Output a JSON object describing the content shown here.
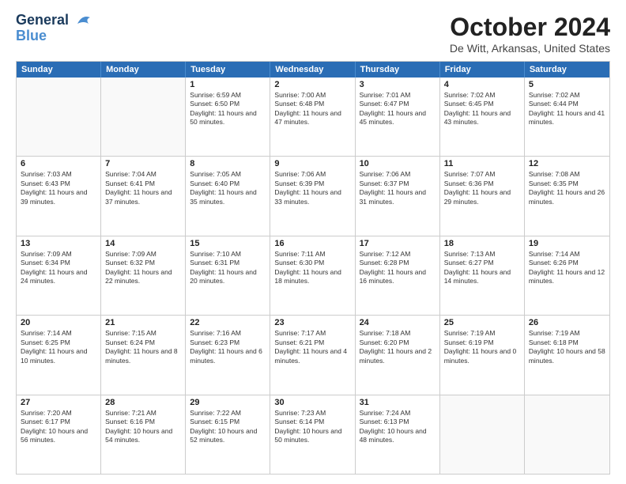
{
  "logo": {
    "line1": "General",
    "line2": "Blue"
  },
  "title": "October 2024",
  "location": "De Witt, Arkansas, United States",
  "days_of_week": [
    "Sunday",
    "Monday",
    "Tuesday",
    "Wednesday",
    "Thursday",
    "Friday",
    "Saturday"
  ],
  "weeks": [
    [
      {
        "day": "",
        "sunrise": "",
        "sunset": "",
        "daylight": ""
      },
      {
        "day": "",
        "sunrise": "",
        "sunset": "",
        "daylight": ""
      },
      {
        "day": "1",
        "sunrise": "Sunrise: 6:59 AM",
        "sunset": "Sunset: 6:50 PM",
        "daylight": "Daylight: 11 hours and 50 minutes."
      },
      {
        "day": "2",
        "sunrise": "Sunrise: 7:00 AM",
        "sunset": "Sunset: 6:48 PM",
        "daylight": "Daylight: 11 hours and 47 minutes."
      },
      {
        "day": "3",
        "sunrise": "Sunrise: 7:01 AM",
        "sunset": "Sunset: 6:47 PM",
        "daylight": "Daylight: 11 hours and 45 minutes."
      },
      {
        "day": "4",
        "sunrise": "Sunrise: 7:02 AM",
        "sunset": "Sunset: 6:45 PM",
        "daylight": "Daylight: 11 hours and 43 minutes."
      },
      {
        "day": "5",
        "sunrise": "Sunrise: 7:02 AM",
        "sunset": "Sunset: 6:44 PM",
        "daylight": "Daylight: 11 hours and 41 minutes."
      }
    ],
    [
      {
        "day": "6",
        "sunrise": "Sunrise: 7:03 AM",
        "sunset": "Sunset: 6:43 PM",
        "daylight": "Daylight: 11 hours and 39 minutes."
      },
      {
        "day": "7",
        "sunrise": "Sunrise: 7:04 AM",
        "sunset": "Sunset: 6:41 PM",
        "daylight": "Daylight: 11 hours and 37 minutes."
      },
      {
        "day": "8",
        "sunrise": "Sunrise: 7:05 AM",
        "sunset": "Sunset: 6:40 PM",
        "daylight": "Daylight: 11 hours and 35 minutes."
      },
      {
        "day": "9",
        "sunrise": "Sunrise: 7:06 AM",
        "sunset": "Sunset: 6:39 PM",
        "daylight": "Daylight: 11 hours and 33 minutes."
      },
      {
        "day": "10",
        "sunrise": "Sunrise: 7:06 AM",
        "sunset": "Sunset: 6:37 PM",
        "daylight": "Daylight: 11 hours and 31 minutes."
      },
      {
        "day": "11",
        "sunrise": "Sunrise: 7:07 AM",
        "sunset": "Sunset: 6:36 PM",
        "daylight": "Daylight: 11 hours and 29 minutes."
      },
      {
        "day": "12",
        "sunrise": "Sunrise: 7:08 AM",
        "sunset": "Sunset: 6:35 PM",
        "daylight": "Daylight: 11 hours and 26 minutes."
      }
    ],
    [
      {
        "day": "13",
        "sunrise": "Sunrise: 7:09 AM",
        "sunset": "Sunset: 6:34 PM",
        "daylight": "Daylight: 11 hours and 24 minutes."
      },
      {
        "day": "14",
        "sunrise": "Sunrise: 7:09 AM",
        "sunset": "Sunset: 6:32 PM",
        "daylight": "Daylight: 11 hours and 22 minutes."
      },
      {
        "day": "15",
        "sunrise": "Sunrise: 7:10 AM",
        "sunset": "Sunset: 6:31 PM",
        "daylight": "Daylight: 11 hours and 20 minutes."
      },
      {
        "day": "16",
        "sunrise": "Sunrise: 7:11 AM",
        "sunset": "Sunset: 6:30 PM",
        "daylight": "Daylight: 11 hours and 18 minutes."
      },
      {
        "day": "17",
        "sunrise": "Sunrise: 7:12 AM",
        "sunset": "Sunset: 6:28 PM",
        "daylight": "Daylight: 11 hours and 16 minutes."
      },
      {
        "day": "18",
        "sunrise": "Sunrise: 7:13 AM",
        "sunset": "Sunset: 6:27 PM",
        "daylight": "Daylight: 11 hours and 14 minutes."
      },
      {
        "day": "19",
        "sunrise": "Sunrise: 7:14 AM",
        "sunset": "Sunset: 6:26 PM",
        "daylight": "Daylight: 11 hours and 12 minutes."
      }
    ],
    [
      {
        "day": "20",
        "sunrise": "Sunrise: 7:14 AM",
        "sunset": "Sunset: 6:25 PM",
        "daylight": "Daylight: 11 hours and 10 minutes."
      },
      {
        "day": "21",
        "sunrise": "Sunrise: 7:15 AM",
        "sunset": "Sunset: 6:24 PM",
        "daylight": "Daylight: 11 hours and 8 minutes."
      },
      {
        "day": "22",
        "sunrise": "Sunrise: 7:16 AM",
        "sunset": "Sunset: 6:23 PM",
        "daylight": "Daylight: 11 hours and 6 minutes."
      },
      {
        "day": "23",
        "sunrise": "Sunrise: 7:17 AM",
        "sunset": "Sunset: 6:21 PM",
        "daylight": "Daylight: 11 hours and 4 minutes."
      },
      {
        "day": "24",
        "sunrise": "Sunrise: 7:18 AM",
        "sunset": "Sunset: 6:20 PM",
        "daylight": "Daylight: 11 hours and 2 minutes."
      },
      {
        "day": "25",
        "sunrise": "Sunrise: 7:19 AM",
        "sunset": "Sunset: 6:19 PM",
        "daylight": "Daylight: 11 hours and 0 minutes."
      },
      {
        "day": "26",
        "sunrise": "Sunrise: 7:19 AM",
        "sunset": "Sunset: 6:18 PM",
        "daylight": "Daylight: 10 hours and 58 minutes."
      }
    ],
    [
      {
        "day": "27",
        "sunrise": "Sunrise: 7:20 AM",
        "sunset": "Sunset: 6:17 PM",
        "daylight": "Daylight: 10 hours and 56 minutes."
      },
      {
        "day": "28",
        "sunrise": "Sunrise: 7:21 AM",
        "sunset": "Sunset: 6:16 PM",
        "daylight": "Daylight: 10 hours and 54 minutes."
      },
      {
        "day": "29",
        "sunrise": "Sunrise: 7:22 AM",
        "sunset": "Sunset: 6:15 PM",
        "daylight": "Daylight: 10 hours and 52 minutes."
      },
      {
        "day": "30",
        "sunrise": "Sunrise: 7:23 AM",
        "sunset": "Sunset: 6:14 PM",
        "daylight": "Daylight: 10 hours and 50 minutes."
      },
      {
        "day": "31",
        "sunrise": "Sunrise: 7:24 AM",
        "sunset": "Sunset: 6:13 PM",
        "daylight": "Daylight: 10 hours and 48 minutes."
      },
      {
        "day": "",
        "sunrise": "",
        "sunset": "",
        "daylight": ""
      },
      {
        "day": "",
        "sunrise": "",
        "sunset": "",
        "daylight": ""
      }
    ]
  ]
}
